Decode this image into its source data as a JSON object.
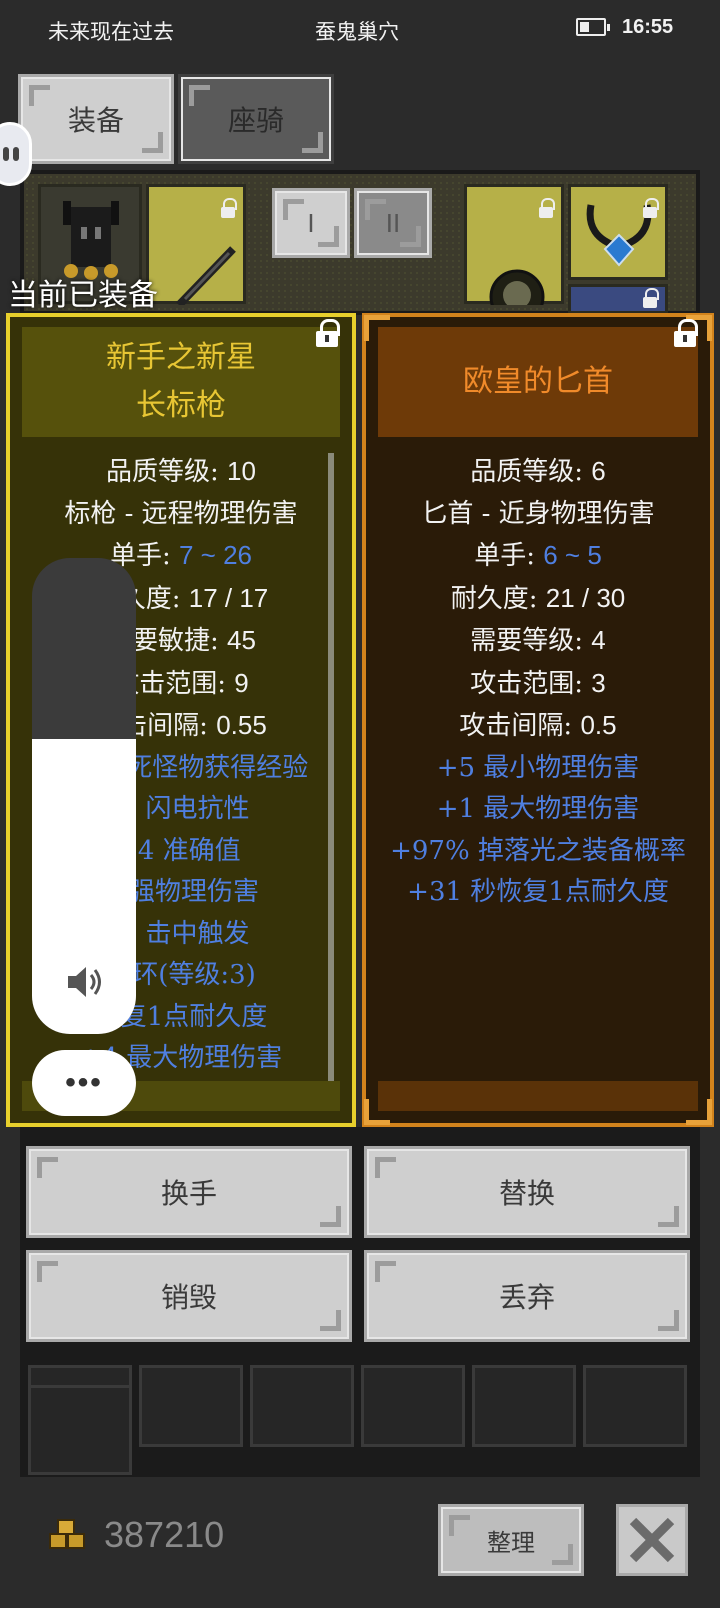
{
  "status_bar": {
    "left_text": "未来现在过去",
    "center_text": "蚕鬼巢穴",
    "time": "16:55"
  },
  "tabs": [
    {
      "label": "装备"
    },
    {
      "label": "座骑"
    }
  ],
  "equip_area": {
    "set_buttons": [
      "I",
      "II"
    ],
    "current_equipped_label": "当前已装备"
  },
  "left_item": {
    "name_line1": "新手之新星",
    "name_line2": "长标枪",
    "stats": [
      {
        "label": "品质等级: ",
        "value": "10"
      },
      {
        "label": "标枪 - 远程物理伤害",
        "value": ""
      },
      {
        "label": "单手: ",
        "value": "7 ~ 26"
      },
      {
        "label": "耐久度: ",
        "value": "17 / 17"
      },
      {
        "label": "需要敏捷: ",
        "value": "45"
      },
      {
        "label": "攻击范围: ",
        "value": "9"
      },
      {
        "label": "攻击间隔: ",
        "value": "0.55"
      }
    ],
    "affixes": [
      "+9 杀死怪物获得经验",
      "% 闪电抗性",
      "14 准确值",
      "增强物理伤害",
      "% 击中触发",
      "光环(等级:3)",
      "恢复1点耐久度",
      "+4 最大物理伤害"
    ]
  },
  "right_item": {
    "name": "欧皇的匕首",
    "stats": [
      {
        "label": "品质等级: ",
        "value": "6"
      },
      {
        "label": "匕首 - 近身物理伤害",
        "value": ""
      },
      {
        "label": "单手: ",
        "value": "6 ~ 5"
      },
      {
        "label": "耐久度: ",
        "value": "21 / 30"
      },
      {
        "label": "需要等级: ",
        "value": "4"
      },
      {
        "label": "攻击范围: ",
        "value": "3"
      },
      {
        "label": "攻击间隔: ",
        "value": "0.5"
      }
    ],
    "affixes": [
      "+5 最小物理伤害",
      "+1 最大物理伤害",
      "+97% 掉落光之装备概率",
      "+31 秒恢复1点耐久度"
    ]
  },
  "actions": {
    "swap_hand": "换手",
    "replace": "替换",
    "destroy": "销毁",
    "discard": "丢弃"
  },
  "overlay": {
    "volume_level": 0.62,
    "more_label": "•••"
  },
  "footer": {
    "gold_amount": "387210",
    "sort_label": "整理"
  },
  "colors": {
    "left_border": "#e7cf2c",
    "right_border": "#d2831c",
    "affix_blue": "#4f7fe0"
  }
}
